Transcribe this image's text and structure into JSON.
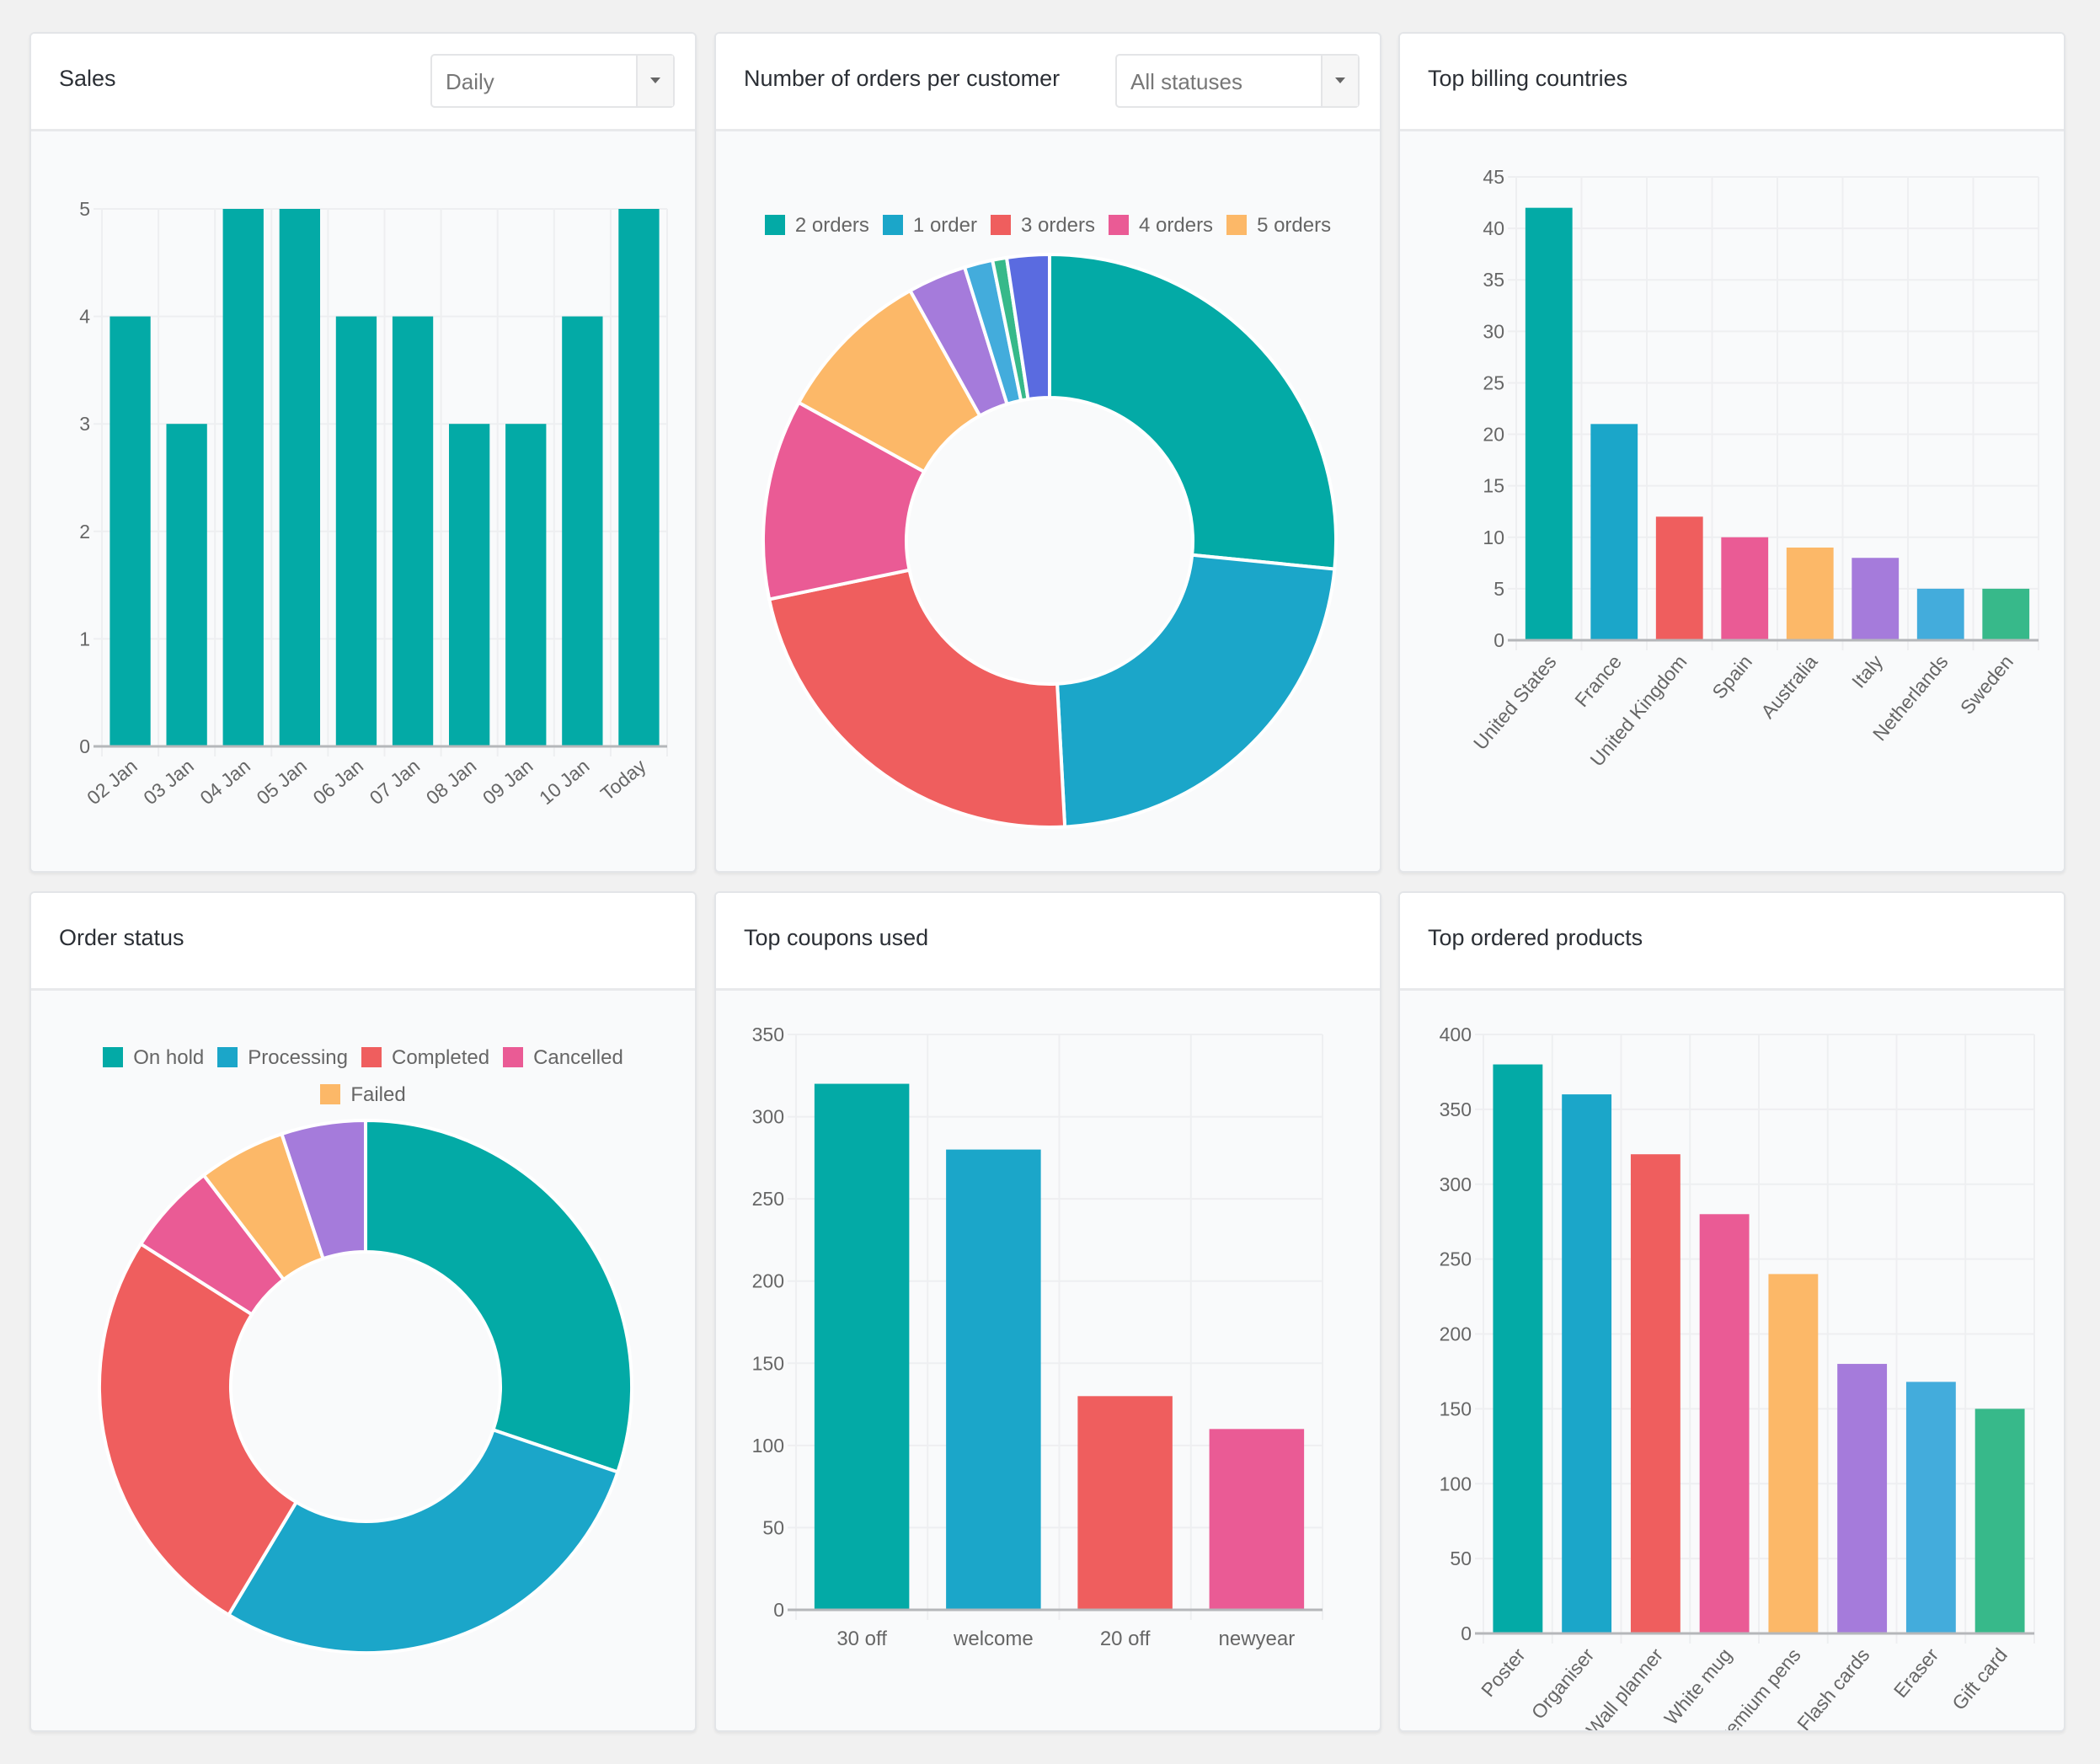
{
  "panels": {
    "sales": {
      "title": "Sales",
      "select_value": "Daily"
    },
    "orders_per_customer": {
      "title": "Number of orders per customer",
      "select_value": "All statuses"
    },
    "billing": {
      "title": "Top billing countries"
    },
    "status": {
      "title": "Order status"
    },
    "coupons": {
      "title": "Top coupons used"
    },
    "products": {
      "title": "Top ordered products"
    }
  },
  "colors": {
    "teal": "#03aaa6",
    "blue": "#1ba6c9",
    "red": "#ef5e5e",
    "pink": "#ea5b95",
    "orange": "#fcb868",
    "purple": "#a57bdb",
    "lightblue": "#43acdc",
    "green": "#37b98a",
    "indigo": "#5a6be0"
  },
  "chart_data": [
    {
      "id": "sales",
      "type": "bar",
      "title": "Sales",
      "categories": [
        "02 Jan",
        "03 Jan",
        "04 Jan",
        "05 Jan",
        "06 Jan",
        "07 Jan",
        "08 Jan",
        "09 Jan",
        "10 Jan",
        "Today"
      ],
      "values": [
        4,
        3,
        5,
        5,
        4,
        4,
        3,
        3,
        4,
        5
      ],
      "ylim": [
        0,
        5
      ],
      "yticks": [
        0,
        1,
        2,
        3,
        4,
        5
      ],
      "grid": true,
      "bar_colors": [
        "#03aaa6"
      ],
      "xlabel_rotation": "angled"
    },
    {
      "id": "orders_per_customer",
      "type": "pie",
      "variant": "doughnut",
      "title": "Number of orders per customer",
      "legend": [
        "2 orders",
        "1 order",
        "3 orders",
        "4 orders",
        "5 orders"
      ],
      "legend_position": "top",
      "slices": [
        {
          "label": "2 orders",
          "percent": 26.6,
          "color": "#03aaa6"
        },
        {
          "label": "1 order",
          "percent": 22.6,
          "color": "#1ba6c9"
        },
        {
          "label": "3 orders",
          "percent": 22.6,
          "color": "#ef5e5e"
        },
        {
          "label": "4 orders",
          "percent": 11.3,
          "color": "#ea5b95"
        },
        {
          "label": "5 orders",
          "percent": 8.9,
          "color": "#fcb868"
        },
        {
          "label": "",
          "percent": 3.3,
          "color": "#a57bdb"
        },
        {
          "label": "",
          "percent": 1.6,
          "color": "#43acdc"
        },
        {
          "label": "",
          "percent": 0.8,
          "color": "#37b98a"
        },
        {
          "label": "",
          "percent": 2.4,
          "color": "#5a6be0"
        }
      ]
    },
    {
      "id": "billing",
      "type": "bar",
      "title": "Top billing countries",
      "categories": [
        "United States",
        "France",
        "United Kingdom",
        "Spain",
        "Australia",
        "Italy",
        "Netherlands",
        "Sweden"
      ],
      "values": [
        42,
        21,
        12,
        10,
        9,
        8,
        5,
        5
      ],
      "ylim": [
        0,
        45
      ],
      "yticks": [
        0,
        5,
        10,
        15,
        20,
        25,
        30,
        35,
        40,
        45
      ],
      "grid": true,
      "bar_colors": [
        "#03aaa6",
        "#1ba6c9",
        "#ef5e5e",
        "#ea5b95",
        "#fcb868",
        "#a57bdb",
        "#43acdc",
        "#37b98a"
      ],
      "xlabel_rotation": "angled"
    },
    {
      "id": "status",
      "type": "pie",
      "variant": "doughnut",
      "title": "Order status",
      "legend": [
        "On hold",
        "Processing",
        "Completed",
        "Cancelled",
        "Failed"
      ],
      "legend_position": "top",
      "slices": [
        {
          "label": "On hold",
          "percent": 30.2,
          "color": "#03aaa6"
        },
        {
          "label": "Processing",
          "percent": 28.4,
          "color": "#1ba6c9"
        },
        {
          "label": "Completed",
          "percent": 25.4,
          "color": "#ef5e5e"
        },
        {
          "label": "Cancelled",
          "percent": 5.6,
          "color": "#ea5b95"
        },
        {
          "label": "Failed",
          "percent": 5.3,
          "color": "#fcb868"
        },
        {
          "label": "",
          "percent": 5.1,
          "color": "#a57bdb"
        }
      ]
    },
    {
      "id": "coupons",
      "type": "bar",
      "title": "Top coupons used",
      "categories": [
        "30 off",
        "welcome",
        "20 off",
        "newyear"
      ],
      "values": [
        320,
        280,
        130,
        110
      ],
      "ylim": [
        0,
        350
      ],
      "yticks": [
        0,
        50,
        100,
        150,
        200,
        250,
        300,
        350
      ],
      "grid": true,
      "bar_colors": [
        "#03aaa6",
        "#1ba6c9",
        "#ef5e5e",
        "#ea5b95"
      ],
      "xlabel_rotation": "none"
    },
    {
      "id": "products",
      "type": "bar",
      "title": "Top ordered products",
      "categories": [
        "Poster",
        "Organiser",
        "Wall planner",
        "White mug",
        "Premium pens",
        "Flash cards",
        "Eraser",
        "Gift card"
      ],
      "values": [
        380,
        360,
        320,
        280,
        240,
        180,
        168,
        150
      ],
      "ylim": [
        0,
        400
      ],
      "yticks": [
        0,
        50,
        100,
        150,
        200,
        250,
        300,
        350,
        400
      ],
      "grid": true,
      "bar_colors": [
        "#03aaa6",
        "#1ba6c9",
        "#ef5e5e",
        "#ea5b95",
        "#fcb868",
        "#a57bdb",
        "#43acdc",
        "#37b98a"
      ],
      "xlabel_rotation": "angled"
    }
  ]
}
